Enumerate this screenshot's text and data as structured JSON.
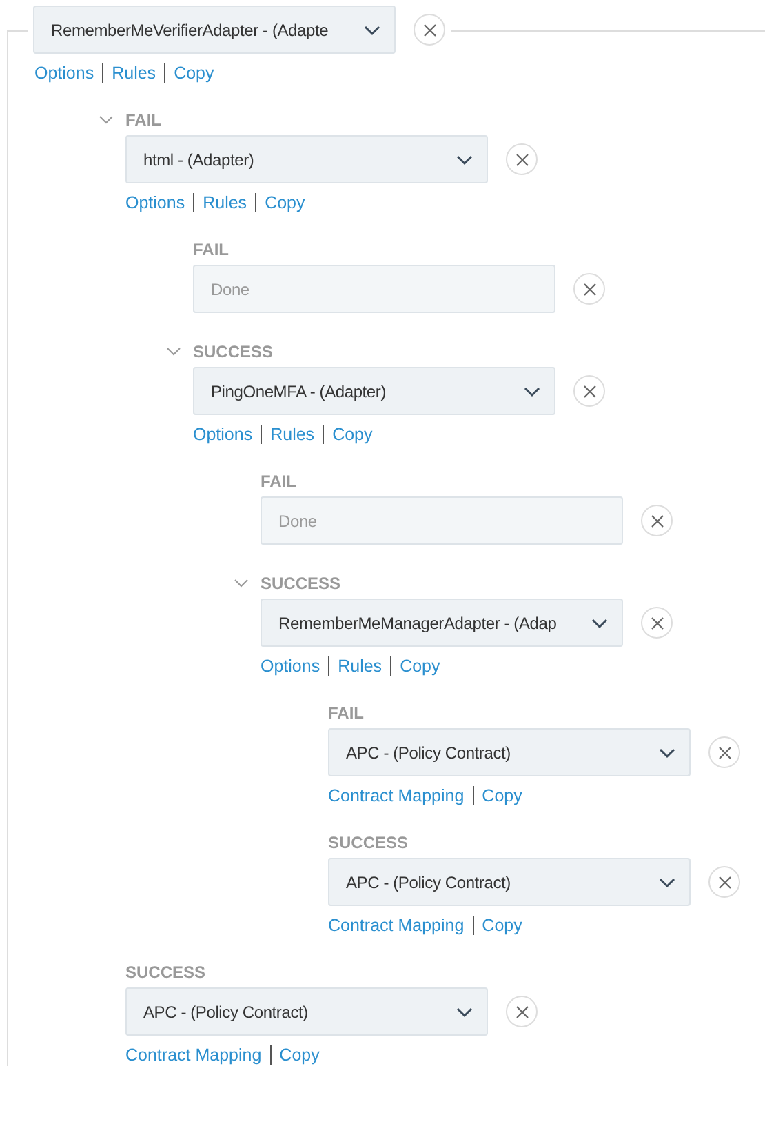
{
  "root": {
    "kind": "select",
    "value": "RememberMeVerifierAdapter - (Adapte",
    "links": [
      "Options",
      "Rules",
      "Copy"
    ],
    "branches": [
      {
        "label": "FAIL",
        "expanded": true,
        "node": {
          "kind": "select",
          "value": "html - (Adapter)",
          "links": [
            "Options",
            "Rules",
            "Copy"
          ],
          "branches": [
            {
              "label": "FAIL",
              "expanded": false,
              "node": {
                "kind": "done",
                "value": "Done"
              }
            },
            {
              "label": "SUCCESS",
              "expanded": true,
              "node": {
                "kind": "select",
                "value": "PingOneMFA - (Adapter)",
                "links": [
                  "Options",
                  "Rules",
                  "Copy"
                ],
                "branches": [
                  {
                    "label": "FAIL",
                    "expanded": false,
                    "node": {
                      "kind": "done",
                      "value": "Done"
                    }
                  },
                  {
                    "label": "SUCCESS",
                    "expanded": true,
                    "node": {
                      "kind": "select",
                      "value": "RememberMeManagerAdapter - (Adap",
                      "links": [
                        "Options",
                        "Rules",
                        "Copy"
                      ],
                      "branches": [
                        {
                          "label": "FAIL",
                          "expanded": false,
                          "node": {
                            "kind": "select",
                            "value": "APC - (Policy Contract)",
                            "links": [
                              "Contract Mapping",
                              "Copy"
                            ]
                          }
                        },
                        {
                          "label": "SUCCESS",
                          "expanded": false,
                          "node": {
                            "kind": "select",
                            "value": "APC - (Policy Contract)",
                            "links": [
                              "Contract Mapping",
                              "Copy"
                            ]
                          }
                        }
                      ]
                    }
                  }
                ]
              }
            }
          ]
        }
      },
      {
        "label": "SUCCESS",
        "expanded": false,
        "node": {
          "kind": "select",
          "value": "APC - (Policy Contract)",
          "links": [
            "Contract Mapping",
            "Copy"
          ]
        }
      }
    ]
  }
}
